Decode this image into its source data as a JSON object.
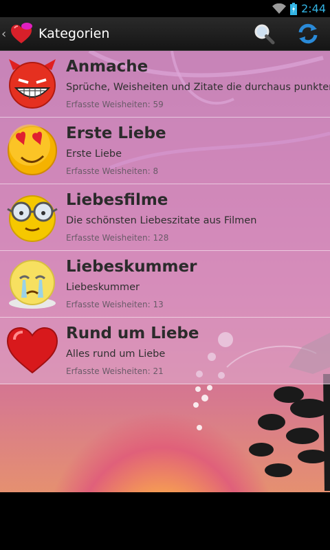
{
  "status_bar": {
    "time": "2:44"
  },
  "action_bar": {
    "title": "Kategorien",
    "icons": [
      "up-caret-icon",
      "app-heart-logo",
      "search-icon",
      "refresh-icon"
    ]
  },
  "categories": [
    {
      "title": "Anmache",
      "description": "Sprüche, Weisheiten und Zitate die durchaus punkten.",
      "count": "Erfasste Weisheiten: 59",
      "icon": "devil-smiley-icon"
    },
    {
      "title": "Erste Liebe",
      "description": "Erste Liebe",
      "count": "Erfasste Weisheiten: 8",
      "icon": "heart-eyes-smiley-icon"
    },
    {
      "title": "Liebesfilme",
      "description": "Die schönsten Liebeszitate aus Filmen",
      "count": "Erfasste Weisheiten: 128",
      "icon": "glasses-smiley-icon"
    },
    {
      "title": "Liebeskummer",
      "description": "Liebeskummer",
      "count": "Erfasste Weisheiten: 13",
      "icon": "crying-smiley-icon"
    },
    {
      "title": "Rund um Liebe",
      "description": "Alles rund um Liebe",
      "count": "Erfasste Weisheiten: 21",
      "icon": "heart-icon"
    }
  ]
}
